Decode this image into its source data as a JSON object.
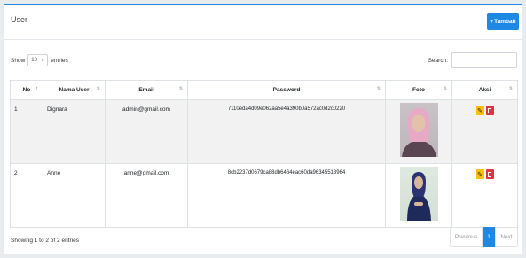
{
  "card": {
    "title": "User",
    "add_button_label": "Tambah",
    "add_icon": "plus-icon"
  },
  "controls": {
    "show_label": "Show",
    "page_length": "10",
    "entries_label": "entries",
    "search_label": "Search:",
    "search_value": ""
  },
  "table": {
    "headers": [
      "No",
      "Nama User",
      "Email",
      "Password",
      "Foto",
      "Aksi"
    ],
    "rows": [
      {
        "no": "1",
        "name": "Dignara",
        "email": "admin@gmail.com",
        "password": "7110eda4d09e062aa5e4a390b0a572ac0d2c0220",
        "photo": "profile-photo-woman-pink-hijab"
      },
      {
        "no": "2",
        "name": "Anne",
        "email": "anne@gmail.com",
        "password": "8cb2237d0679ca88db6464eac60da96345513964",
        "photo": "profile-photo-woman-navy-hijab"
      }
    ]
  },
  "footer": {
    "info": "Showing 1 to 2 of 2 entries",
    "prev_label": "Previous",
    "current_page": "1",
    "next_label": "Next"
  },
  "colors": {
    "primary": "#1e88e5",
    "edit": "#ffc107",
    "delete": "#dc3545"
  }
}
